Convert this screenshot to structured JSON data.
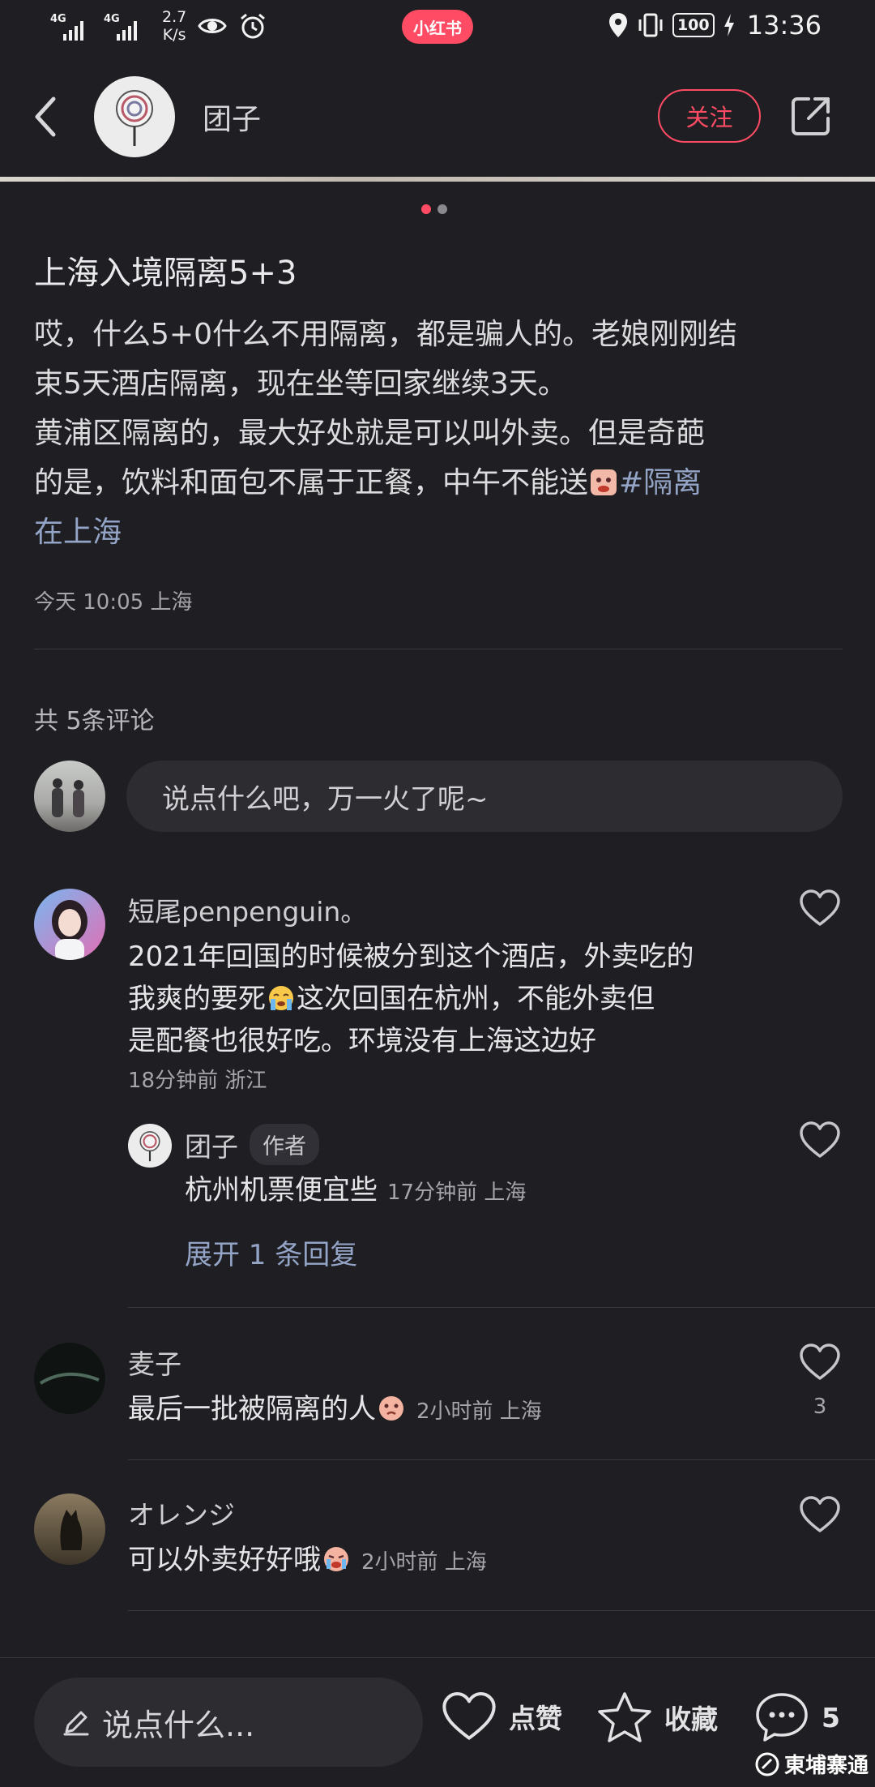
{
  "status_bar": {
    "net1": "4G",
    "net2": "4G",
    "speed_value": "2.7",
    "speed_unit": "K/s",
    "app_pill": "小红书",
    "battery": "100",
    "time": "13:36"
  },
  "header": {
    "username": "团子",
    "follow_label": "关注"
  },
  "post": {
    "title": "上海入境隔离5+3",
    "lines": [
      "哎，什么5+0什么不用隔离，都是骗人的。老娘刚刚结",
      "束5天酒店隔离，现在坐等回家继续3天。",
      "黄浦区隔离的，最大好处就是可以叫外卖。但是奇葩",
      "的是，饮料和面包不属于正餐，中午不能送"
    ],
    "hashtag_part1": "#隔离",
    "hashtag_part2": "在上海",
    "meta": "今天 10:05 上海"
  },
  "comments_header": {
    "count_label": "共 5条评论",
    "input_placeholder": "说点什么吧，万一火了呢~"
  },
  "comments": [
    {
      "name": "短尾penpenguin。",
      "line1": "2021年回国的时候被分到这个酒店，外卖吃的",
      "line2a": "我爽的要死",
      "line2b": "这次回国在杭州，不能外卖但",
      "line3": "是配餐也很好吃。环境没有上海这边好",
      "meta": "18分钟前 浙江"
    },
    {
      "name": "麦子",
      "text": "最后一批被隔离的人",
      "meta": "2小时前 上海",
      "likes": "3"
    },
    {
      "name": "オレンジ",
      "text": "可以外卖好好哦",
      "meta": "2小时前 上海"
    }
  ],
  "reply": {
    "name": "团子",
    "badge": "作者",
    "text": "杭州机票便宜些",
    "meta": "17分钟前 上海",
    "expand": "展开 1 条回复"
  },
  "bottom_bar": {
    "input_label": "说点什么...",
    "like_label": "点赞",
    "collect_label": "收藏",
    "comment_count": "5"
  },
  "watermark": "東埔寨通",
  "colors": {
    "background": "#1f1f23",
    "accent": "#ff4b63",
    "hashtag": "#93a4c6"
  }
}
